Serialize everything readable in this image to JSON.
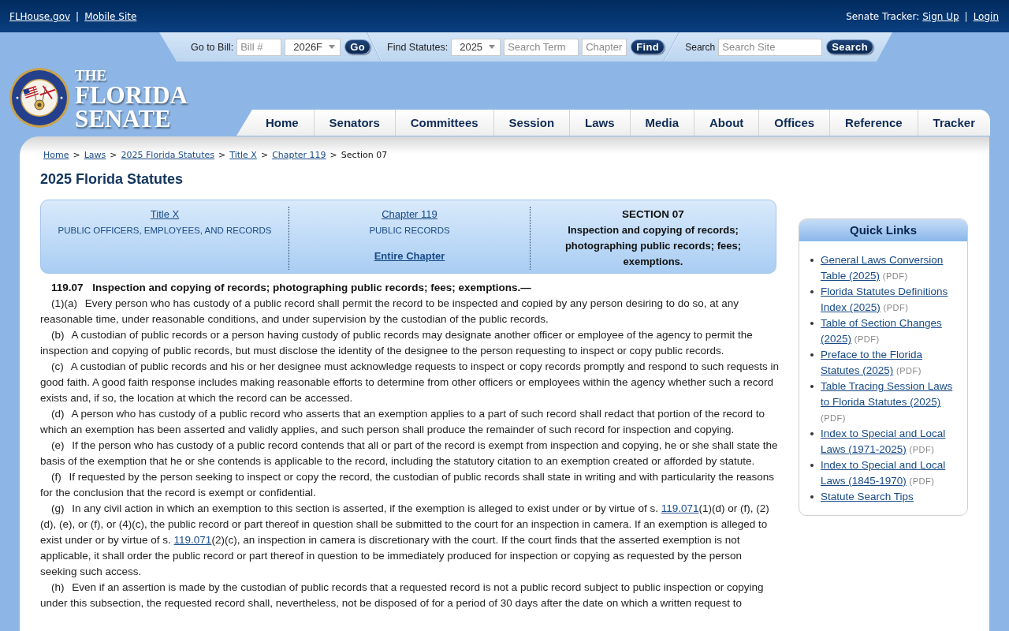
{
  "top_bar": {
    "left": {
      "links": [
        "FLHouse.gov",
        "Mobile Site"
      ],
      "separator": "|"
    },
    "right": {
      "label": "Senate Tracker:",
      "links": [
        "Sign Up",
        "Login"
      ],
      "separator": "|"
    }
  },
  "toolbar": {
    "groups": [
      {
        "label": "Go to Bill:",
        "controls": [
          {
            "kind": "input",
            "placeholder": "Bill #"
          },
          {
            "kind": "select",
            "value": "2026F"
          },
          {
            "kind": "button",
            "label": "Go"
          }
        ]
      },
      {
        "label": "Find Statutes:",
        "controls": [
          {
            "kind": "select",
            "value": "2025"
          },
          {
            "kind": "input",
            "placeholder": "Search Term"
          },
          {
            "kind": "input",
            "placeholder": "Chapter"
          },
          {
            "kind": "button",
            "label": "Find"
          }
        ]
      },
      {
        "label": "Search",
        "controls": [
          {
            "kind": "input",
            "placeholder": "Search Site"
          },
          {
            "kind": "button",
            "label": "Search"
          }
        ]
      }
    ]
  },
  "logo": {
    "lines": [
      "THE",
      "FLORIDA",
      "SENATE"
    ]
  },
  "nav": {
    "items": [
      "Home",
      "Senators",
      "Committees",
      "Session",
      "Laws",
      "Media",
      "About",
      "Offices",
      "Reference",
      "Tracker"
    ]
  },
  "breadcrumb": [
    {
      "label": "Home",
      "kind": "link",
      "separator": ">"
    },
    {
      "label": "Laws",
      "kind": "link",
      "separator": ">"
    },
    {
      "label": "2025 Florida Statutes",
      "kind": "link",
      "separator": ">"
    },
    {
      "label": "Title X",
      "kind": "link",
      "separator": ">"
    },
    {
      "label": "Chapter 119",
      "kind": "link",
      "separator": ">"
    },
    {
      "label": "Section 07",
      "kind": "current"
    }
  ],
  "page_title": "2025 Florida Statutes",
  "statute_header": {
    "title": {
      "link": "Title X",
      "name": "PUBLIC OFFICERS, EMPLOYEES, AND RECORDS"
    },
    "chapter": {
      "link": "Chapter 119",
      "name": "PUBLIC RECORDS",
      "entire_link": "Entire Chapter"
    },
    "section": {
      "heading": "SECTION 07",
      "name": "Inspection and copying of records; photographing public records; fees; exemptions."
    }
  },
  "statute": {
    "number": "119.07",
    "title": "Inspection and copying of records; photographing public records; fees; exemptions.—",
    "paragraphs": [
      {
        "label": "(1)(a)",
        "parts": [
          {
            "kind": "text",
            "text": "Every person who has custody of a public record shall permit the record to be inspected and copied by any person desiring to do so, at any reasonable time, under reasonable conditions, and under supervision by the custodian of the public records."
          }
        ]
      },
      {
        "label": "(b)",
        "parts": [
          {
            "kind": "text",
            "text": "A custodian of public records or a person having custody of public records may designate another officer or employee of the agency to permit the inspection and copying of public records, but must disclose the identity of the designee to the person requesting to inspect or copy public records."
          }
        ]
      },
      {
        "label": "(c)",
        "parts": [
          {
            "kind": "text",
            "text": "A custodian of public records and his or her designee must acknowledge requests to inspect or copy records promptly and respond to such requests in good faith. A good faith response includes making reasonable efforts to determine from other officers or employees within the agency whether such a record exists and, if so, the location at which the record can be accessed."
          }
        ]
      },
      {
        "label": "(d)",
        "parts": [
          {
            "kind": "text",
            "text": "A person who has custody of a public record who asserts that an exemption applies to a part of such record shall redact that portion of the record to which an exemption has been asserted and validly applies, and such person shall produce the remainder of such record for inspection and copying."
          }
        ]
      },
      {
        "label": "(e)",
        "parts": [
          {
            "kind": "text",
            "text": "If the person who has custody of a public record contends that all or part of the record is exempt from inspection and copying, he or she shall state the basis of the exemption that he or she contends is applicable to the record, including the statutory citation to an exemption created or afforded by statute."
          }
        ]
      },
      {
        "label": "(f)",
        "parts": [
          {
            "kind": "text",
            "text": "If requested by the person seeking to inspect or copy the record, the custodian of public records shall state in writing and with particularity the reasons for the conclusion that the record is exempt or confidential."
          }
        ]
      },
      {
        "label": "(g)",
        "parts": [
          {
            "kind": "text",
            "text": "In any civil action in which an exemption to this section is asserted, if the exemption is alleged to exist under or by virtue of s. "
          },
          {
            "kind": "link",
            "text": "119.071"
          },
          {
            "kind": "text",
            "text": "(1)(d) or (f), (2)(d), (e), or (f), or (4)(c), the public record or part thereof in question shall be submitted to the court for an inspection in camera. If an exemption is alleged to exist under or by virtue of s. "
          },
          {
            "kind": "link",
            "text": "119.071"
          },
          {
            "kind": "text",
            "text": "(2)(c), an inspection in camera is discretionary with the court. If the court finds that the asserted exemption is not applicable, it shall order the public record or part thereof in question to be immediately produced for inspection or copying as requested by the person seeking such access."
          }
        ]
      },
      {
        "label": "(h)",
        "parts": [
          {
            "kind": "text",
            "text": "Even if an assertion is made by the custodian of public records that a requested record is not a public record subject to public inspection or copying under this subsection, the requested record shall, nevertheless, not be disposed of for a period of 30 days after the date on which a written request to"
          }
        ]
      }
    ]
  },
  "quick_links": {
    "title": "Quick Links",
    "items": [
      {
        "link": "General Laws Conversion Table (2025)",
        "note": "(PDF)"
      },
      {
        "link": "Florida Statutes Definitions Index (2025)",
        "note": "(PDF)"
      },
      {
        "link": "Table of Section Changes (2025)",
        "note": "(PDF)"
      },
      {
        "link": "Preface to the Florida Statutes (2025)",
        "note": "(PDF)"
      },
      {
        "link": "Table Tracing Session Laws to Florida Statutes (2025)",
        "note": "(PDF)"
      },
      {
        "link": "Index to Special and Local Laws (1971-2025)",
        "note": "(PDF)"
      },
      {
        "link": "Index to Special and Local Laws (1845-1970)",
        "note": "(PDF)"
      },
      {
        "link": "Statute Search Tips"
      }
    ]
  }
}
